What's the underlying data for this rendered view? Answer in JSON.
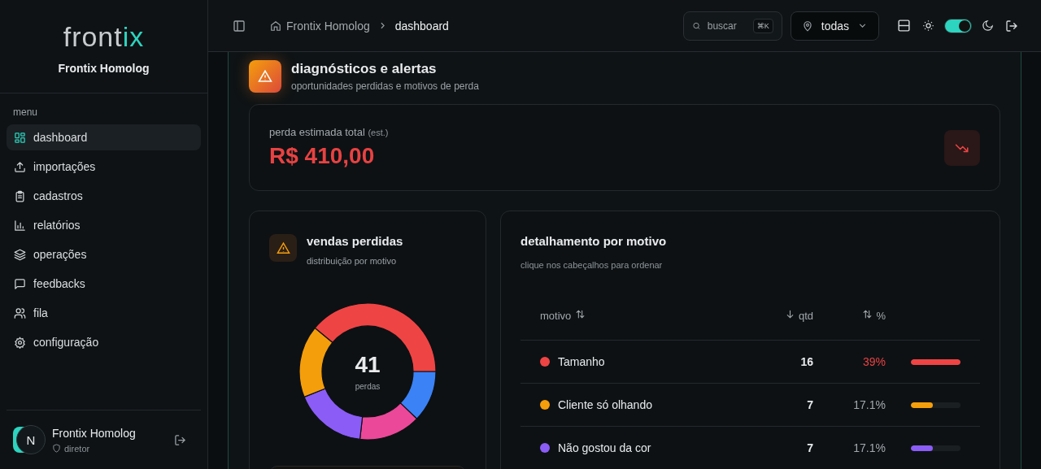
{
  "brand": {
    "logo_main": "front",
    "logo_accent": "ix",
    "name": "Frontix Homolog"
  },
  "menu": {
    "title": "menu",
    "items": [
      {
        "label": "dashboard",
        "selected": true
      },
      {
        "label": "importações",
        "selected": false
      },
      {
        "label": "cadastros",
        "selected": false
      },
      {
        "label": "relatórios",
        "selected": false
      },
      {
        "label": "operações",
        "selected": false
      },
      {
        "label": "feedbacks",
        "selected": false
      },
      {
        "label": "fila",
        "selected": false
      },
      {
        "label": "configuração",
        "selected": false
      }
    ]
  },
  "user": {
    "initial": "N",
    "name": "Frontix Homolog",
    "role": "diretor"
  },
  "header": {
    "breadcrumb": [
      "Frontix Homolog",
      "dashboard"
    ],
    "search": {
      "placeholder": "buscar",
      "shortcut": "⌘K"
    },
    "location": "todas",
    "dark_mode": true
  },
  "page": {
    "title": "diagnósticos e alertas",
    "subtitle": "oportunidades perdidas e motivos de perda"
  },
  "total": {
    "label": "perda estimada total",
    "note": "(est.)",
    "value": "R$ 410,00"
  },
  "lost_sales": {
    "title": "vendas perdidas",
    "subtitle": "distribuição por motivo",
    "total": "41",
    "total_label": "perdas",
    "chart_data": {
      "type": "donut",
      "values": [
        12.2,
        14.6,
        17.1,
        17.1,
        39
      ],
      "colors": [
        "#3b82f6",
        "#ec4899",
        "#8b5cf6",
        "#f59e0b",
        "#ef4444"
      ]
    }
  },
  "breakdown": {
    "title": "detalhamento por motivo",
    "hint": "clique nos cabeçalhos para ordenar",
    "columns": [
      {
        "label": "motivo",
        "kind": "sortable"
      },
      {
        "label": "qtd",
        "kind": "sorted"
      },
      {
        "label": "%",
        "kind": "sortable"
      }
    ],
    "rows": [
      {
        "color": "#ef4444",
        "reason": "Tamanho",
        "qty": "16",
        "percent": "39%",
        "top": true,
        "level": 1
      },
      {
        "color": "#f59e0b",
        "reason": "Cliente só olhando",
        "qty": "7",
        "percent": "17.1%",
        "top": false,
        "level": 0.44
      },
      {
        "color": "#8b5cf6",
        "reason": "Não gostou da cor",
        "qty": "7",
        "percent": "17.1%",
        "top": false,
        "level": 0.44
      }
    ]
  }
}
